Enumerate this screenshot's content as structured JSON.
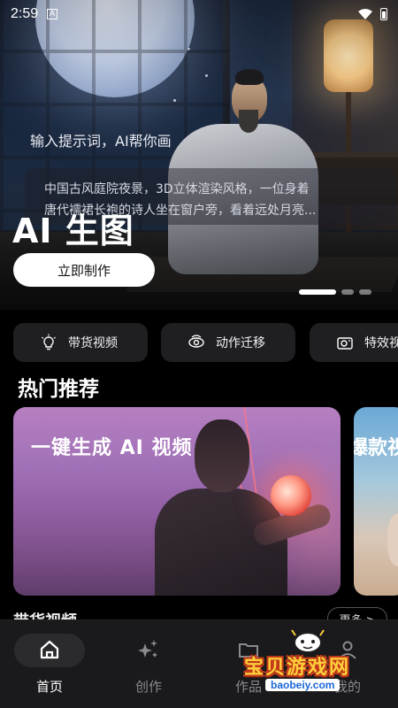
{
  "status_bar": {
    "time": "2:59",
    "notification_glyph": "A"
  },
  "hero": {
    "prompt_label": "输入提示词，AI帮你画",
    "prompt_lines": [
      "中国古风庭院夜景，3D立体渲染风格，一位身着",
      "唐代襦裙长袍的诗人坐在窗户旁，看着远处月亮..."
    ],
    "title": "AI 生图",
    "cta_label": "立即制作",
    "carousel_pages": 3,
    "carousel_active": 0
  },
  "chips": [
    {
      "label": "带货视频",
      "icon": "lightbulb-icon"
    },
    {
      "label": "动作迁移",
      "icon": "motion-icon"
    },
    {
      "label": "特效视频",
      "icon": "camera-icon"
    }
  ],
  "section_title": "热门推荐",
  "cards": [
    {
      "title": "一键生成 AI 视频"
    },
    {
      "title": "爆款视频"
    }
  ],
  "section2": {
    "title": "带货视频",
    "more_label": "更多 >"
  },
  "tabbar": [
    {
      "label": "首页",
      "icon": "home-icon",
      "active": true
    },
    {
      "label": "创作",
      "icon": "sparkle-icon",
      "active": false
    },
    {
      "label": "作品",
      "icon": "folder-icon",
      "active": false
    },
    {
      "label": "我的",
      "icon": "profile-icon",
      "active": false
    }
  ],
  "watermark": {
    "title": "宝贝游戏网",
    "url": "baobeiy.com"
  },
  "colors": {
    "background": "#000000",
    "card_bg": "#1f1f22",
    "tabbar_bg": "#1a1a1c",
    "accent": "#ffffff"
  }
}
